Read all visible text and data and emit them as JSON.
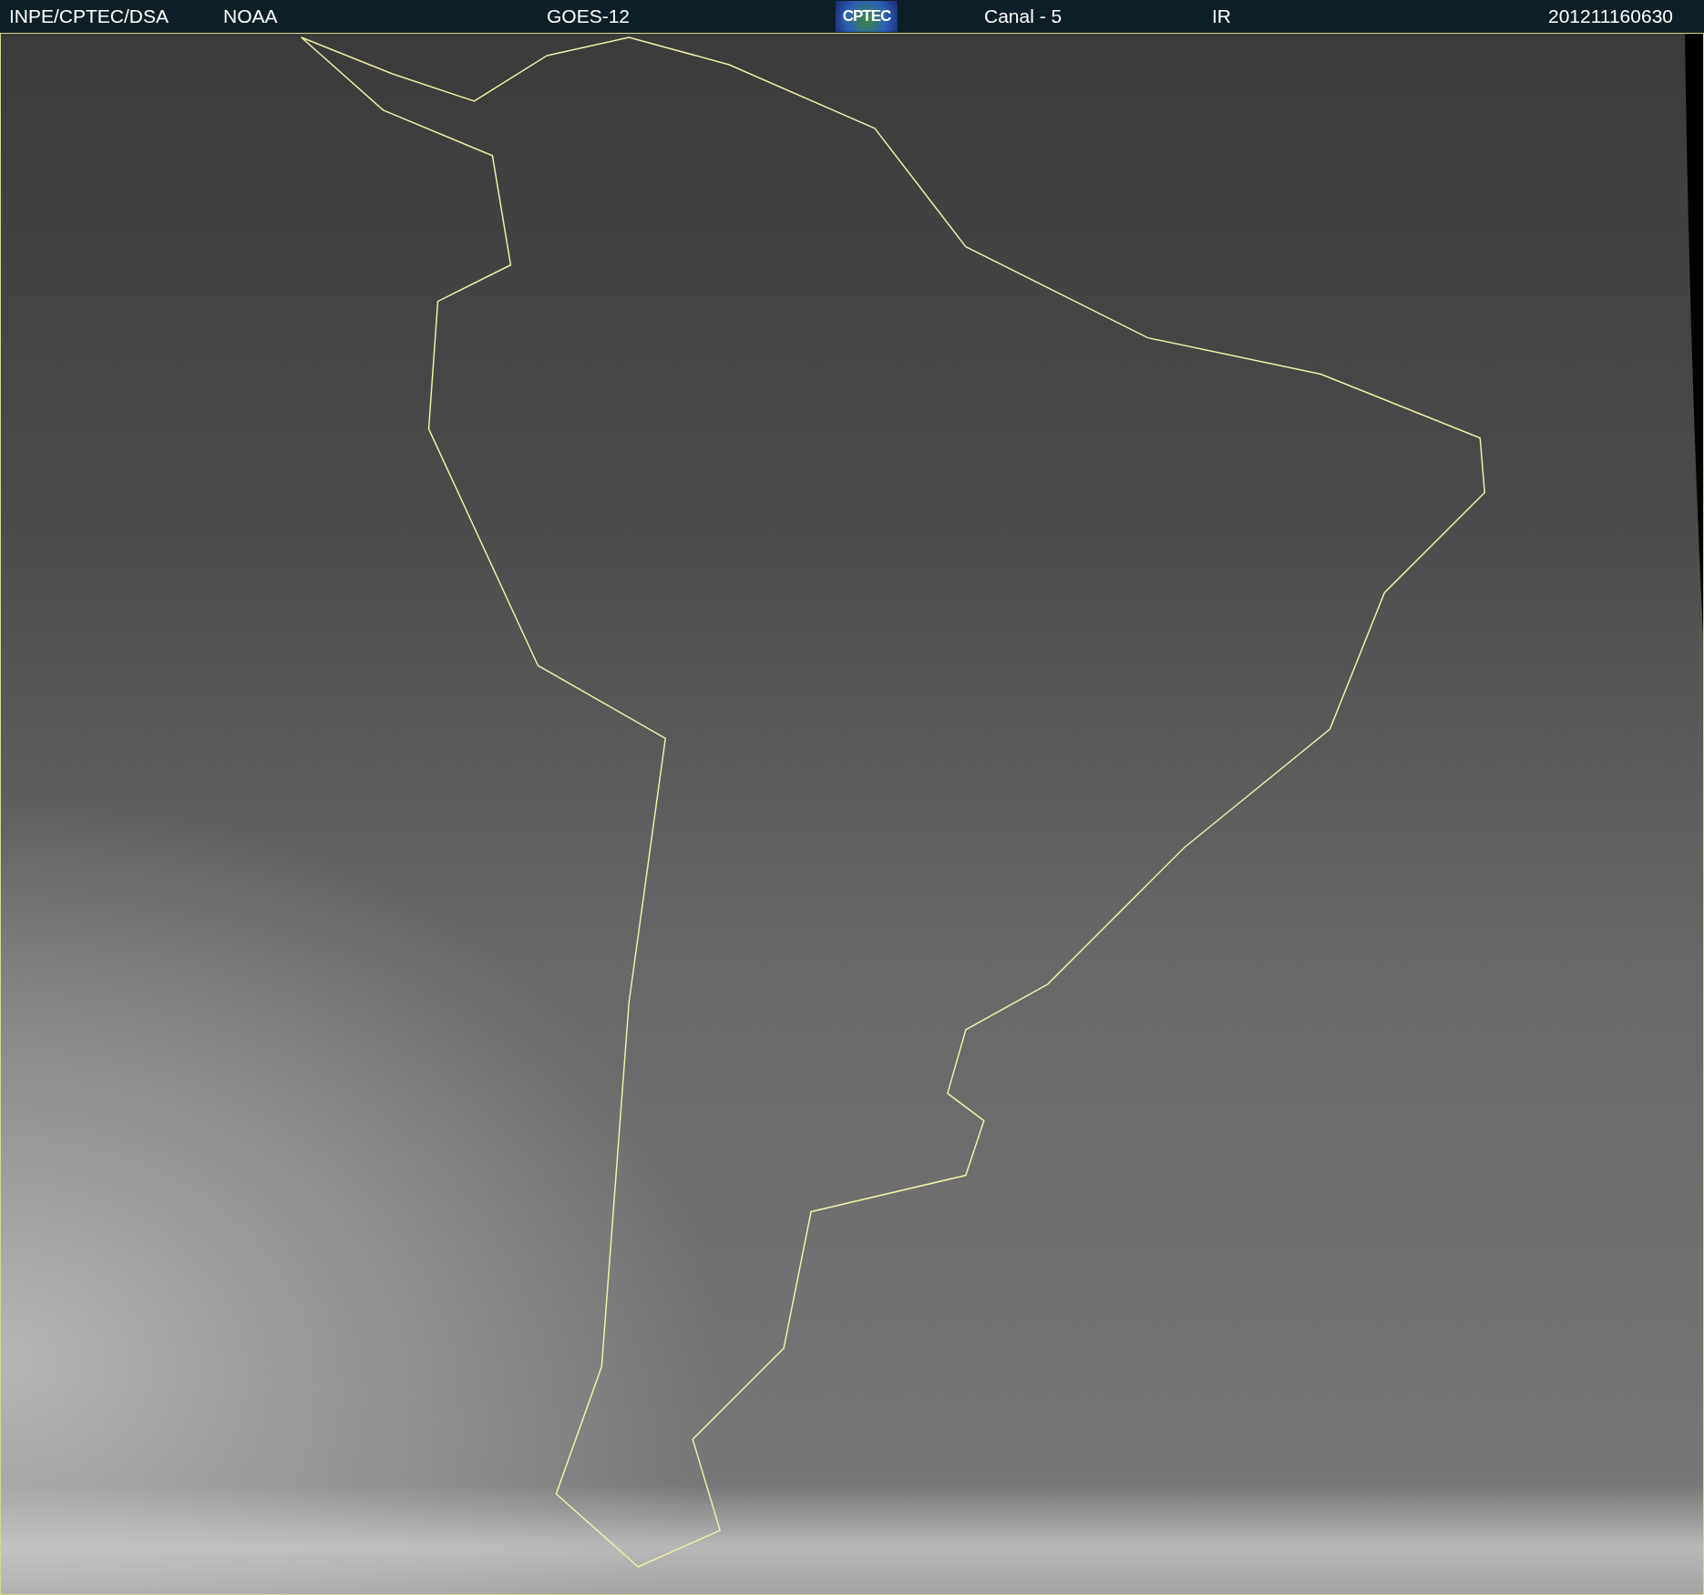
{
  "header": {
    "source": "INPE/CPTEC/DSA",
    "agency": "NOAA",
    "satellite": "GOES-12",
    "logo": "CPTEC",
    "channel": "Canal - 5",
    "band": "IR",
    "timestamp": "201211160630"
  }
}
